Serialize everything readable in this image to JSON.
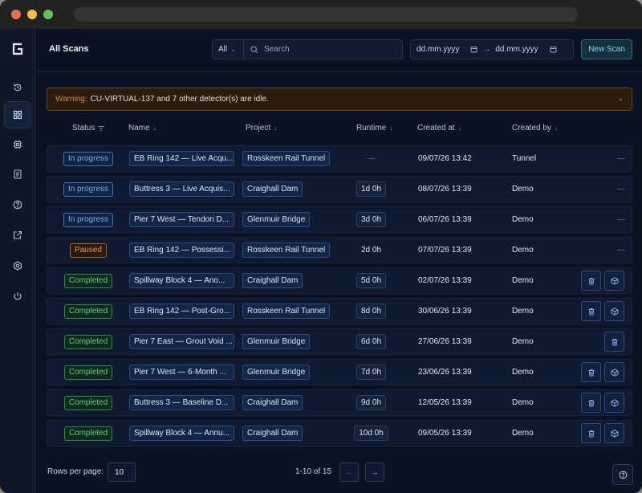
{
  "header": {
    "title": "All Scans",
    "filter_value": "All",
    "search_placeholder": "Search",
    "date_from_placeholder": "dd.mm.yyyy",
    "date_to_placeholder": "dd.mm.yyyy",
    "date_arrow": "→",
    "new_scan_label": "New Scan"
  },
  "warning": {
    "label": "Warning:",
    "text": "CU-VIRTUAL-137 and 7 other detector(s) are idle."
  },
  "table": {
    "columns": [
      "Status",
      "Name",
      "Project",
      "Runtime",
      "Created at",
      "Created by"
    ],
    "rows": [
      {
        "status": "In progress",
        "status_kind": "progress",
        "name": "EB Ring 142 — Live Acqu...",
        "project": "Rosskeen Rail Tunnel",
        "runtime": "—",
        "created_at": "09/07/26 13:42",
        "created_by": "Tunnel",
        "actions": "dash"
      },
      {
        "status": "In progress",
        "status_kind": "progress",
        "name": "Buttress 3 — Live Acquis...",
        "project": "Craighall Dam",
        "runtime": "1d 0h",
        "created_at": "08/07/26 13:39",
        "created_by": "Demo",
        "actions": "dash"
      },
      {
        "status": "In progress",
        "status_kind": "progress",
        "name": "Pier 7 West — Tendon D...",
        "project": "Glenmuir Bridge",
        "runtime": "3d 0h",
        "created_at": "06/07/26 13:39",
        "created_by": "Demo",
        "actions": "dash"
      },
      {
        "status": "Paused",
        "status_kind": "paused",
        "name": "EB Ring 142 — Possessi...",
        "project": "Rosskeen Rail Tunnel",
        "runtime": "2d 0h",
        "created_at": "07/07/26 13:39",
        "created_by": "Demo",
        "actions": "dash"
      },
      {
        "status": "Completed",
        "status_kind": "completed",
        "name": "Spillway Block 4 — Ano...",
        "project": "Craighall Dam",
        "runtime": "5d 0h",
        "created_at": "02/07/26 13:39",
        "created_by": "Demo",
        "actions": "both"
      },
      {
        "status": "Completed",
        "status_kind": "completed",
        "name": "EB Ring 142 — Post-Gro...",
        "project": "Rosskeen Rail Tunnel",
        "runtime": "8d 0h",
        "created_at": "30/06/26 13:39",
        "created_by": "Demo",
        "actions": "both"
      },
      {
        "status": "Completed",
        "status_kind": "completed",
        "name": "Pier 7 East — Grout Void ...",
        "project": "Glenmuir Bridge",
        "runtime": "6d 0h",
        "created_at": "27/06/26 13:39",
        "created_by": "Demo",
        "actions": "delete"
      },
      {
        "status": "Completed",
        "status_kind": "completed",
        "name": "Pier 7 West — 6-Month ...",
        "project": "Glenmuir Bridge",
        "runtime": "7d 0h",
        "created_at": "23/06/26 13:39",
        "created_by": "Demo",
        "actions": "both"
      },
      {
        "status": "Completed",
        "status_kind": "completed",
        "name": "Buttress 3 — Baseline D...",
        "project": "Craighall Dam",
        "runtime": "9d 0h",
        "created_at": "12/05/26 13:39",
        "created_by": "Demo",
        "actions": "both"
      },
      {
        "status": "Completed",
        "status_kind": "completed",
        "name": "Spillway Block 4 — Annu...",
        "project": "Craighall Dam",
        "runtime": "10d 0h",
        "created_at": "09/05/26 13:39",
        "created_by": "Demo",
        "actions": "both"
      }
    ]
  },
  "footer": {
    "rows_per_page_label": "Rows per page:",
    "rows_per_page_value": "10",
    "range_text": "1-10 of 15",
    "prev_label": "←",
    "next_label": "→"
  },
  "sidebar": {
    "items": [
      "history-icon",
      "dashboard-icon",
      "detector-chip-icon",
      "report-document-icon",
      "help-circle-icon",
      "external-link-icon",
      "settings-gear-icon",
      "power-icon"
    ]
  },
  "colors": {
    "background": "#0b1224",
    "accent": "#7fd6e8",
    "in_progress": "#74aef0",
    "paused": "#e7934e",
    "completed": "#55cf83",
    "warning": "#d58a3a"
  }
}
